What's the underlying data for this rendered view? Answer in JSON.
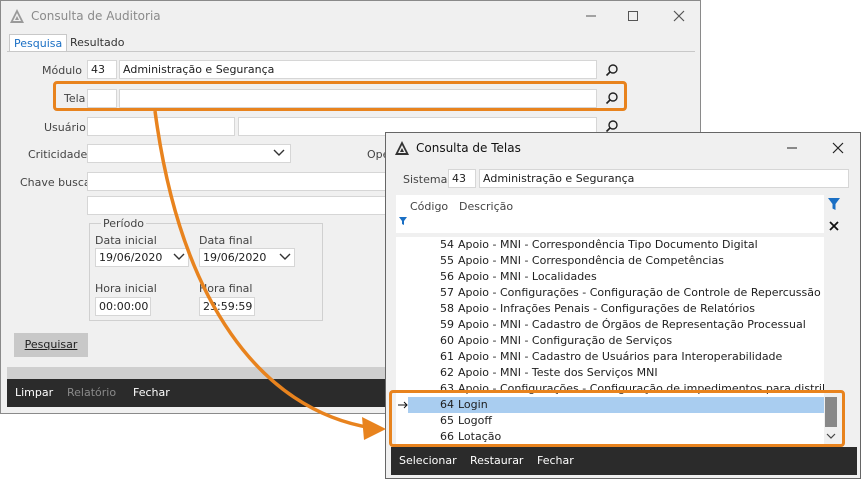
{
  "auditoria": {
    "title": "Consulta de Auditoria",
    "tabs": [
      "Pesquisa",
      "Resultado"
    ],
    "labels": {
      "modulo": "Módulo",
      "tela": "Tela",
      "usuario": "Usuário",
      "criticidade": "Criticidade",
      "chave_busca": "Chave busca",
      "periodo": "Período",
      "data_inicial": "Data inicial",
      "data_final": "Data final",
      "hora_inicial": "Hora inicial",
      "hora_final": "Hora final",
      "ope": "Ope"
    },
    "values": {
      "modulo_code": "43",
      "modulo_desc": "Administração e Segurança",
      "data_inicial": "19/06/2020",
      "data_final": "19/06/2020",
      "hora_inicial": "00:00:00",
      "hora_final": "23:59:59"
    },
    "search_button": "Pesquisar",
    "bottom": [
      "Limpar",
      "Relatório",
      "Fechar"
    ]
  },
  "telas": {
    "title": "Consulta de Telas",
    "sistema_label": "Sistema",
    "sistema_code": "43",
    "sistema_desc": "Administração e Segurança",
    "col_codigo": "Código",
    "col_descricao": "Descrição",
    "rows": [
      {
        "code": "54",
        "desc": "Apoio - MNI - Correspondência Tipo Documento Digital"
      },
      {
        "code": "55",
        "desc": "Apoio - MNI - Correspondência de Competências"
      },
      {
        "code": "56",
        "desc": "Apoio - MNI - Localidades"
      },
      {
        "code": "57",
        "desc": "Apoio - Configurações - Configuração de Controle de Repercussão Gera"
      },
      {
        "code": "58",
        "desc": "Apoio - Infrações Penais - Configurações de Relatórios"
      },
      {
        "code": "59",
        "desc": "Apoio - MNI - Cadastro de Órgãos de Representação Processual"
      },
      {
        "code": "60",
        "desc": "Apoio - MNI - Configuração de Serviços"
      },
      {
        "code": "61",
        "desc": "Apoio - MNI - Cadastro de Usuários para Interoperabilidade"
      },
      {
        "code": "62",
        "desc": "Apoio - MNI - Teste dos Serviços MNI"
      },
      {
        "code": "63",
        "desc": "Apoio - Configurações - Configuração de impedimentos para distribuiçã"
      },
      {
        "code": "64",
        "desc": "Login"
      },
      {
        "code": "65",
        "desc": "Logoff"
      },
      {
        "code": "66",
        "desc": "Lotação"
      }
    ],
    "selected_index": 10,
    "bottom": [
      "Selecionar",
      "Restaurar",
      "Fechar"
    ]
  },
  "colors": {
    "accent_highlight": "#e8831e",
    "tab_active": "#1a6fc4",
    "selected_row": "#a9cdf0",
    "bar_dark": "#2b2b2b"
  },
  "icons": [
    "app-logo-icon",
    "minimize-icon",
    "maximize-icon",
    "close-icon",
    "search-icon",
    "chevron-down-icon",
    "filter-icon",
    "clear-filter-icon",
    "row-pointer-icon"
  ]
}
